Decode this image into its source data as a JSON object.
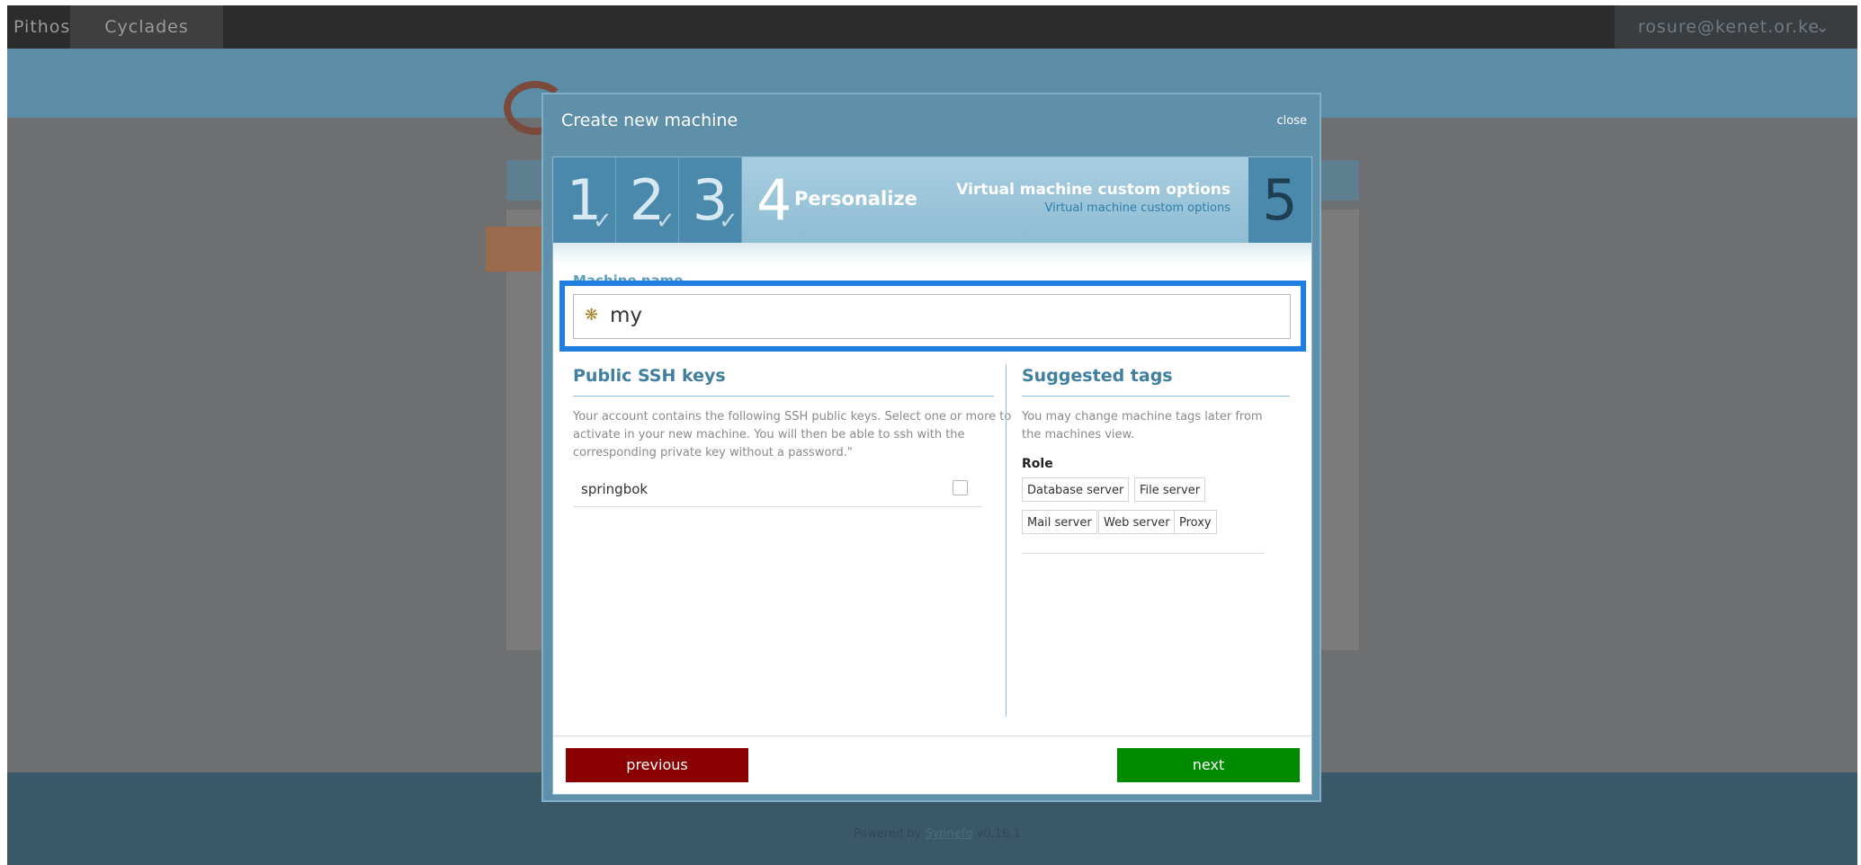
{
  "topbar": {
    "nav": [
      "Pithos",
      "Cyclades"
    ],
    "user": "rosure@kenet.or.ke",
    "user_chevron": "chevron-down-icon"
  },
  "background": {
    "footer_prefix": "Powered by ",
    "footer_link": "Synnefo",
    "footer_version": " v0.16.1"
  },
  "modal": {
    "title": "Create new machine",
    "close": "close",
    "steps": {
      "done": [
        "1",
        "2",
        "3"
      ],
      "active_number": "4",
      "active_label": "Personalize",
      "active_title": "Virtual machine custom options",
      "active_subtitle": "Virtual machine custom options",
      "next_number": "5"
    },
    "machine_name": {
      "label": "Machine name",
      "value": "my",
      "icon": "puzzle-icon"
    },
    "ssh": {
      "title": "Public SSH keys",
      "description": "Your account contains the following SSH public keys. Select one or more to activate in your new machine. You will then be able to ssh with the corresponding private key without a password.\"",
      "keys": [
        {
          "name": "springbok",
          "checked": false
        }
      ]
    },
    "tags": {
      "title": "Suggested tags",
      "description": "You may change machine tags later from the machines view.",
      "role_label": "Role",
      "items": [
        "Database server",
        "File server",
        "Mail server",
        "Web server",
        "Proxy"
      ]
    },
    "buttons": {
      "previous": "previous",
      "next": "next"
    }
  },
  "colors": {
    "accent": "#4a89ab",
    "highlight": "#1e7fe0",
    "previous": "#8b0000",
    "next": "#008a00"
  }
}
